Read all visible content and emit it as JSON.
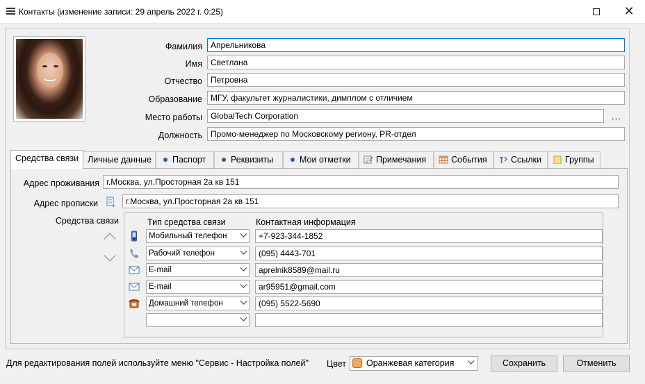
{
  "window": {
    "title": "Контакты  (изменение записи: 29 апрель 2022 г. 0:25)",
    "maximize_label": "☐",
    "close_label": "✕"
  },
  "person": {
    "fields": [
      {
        "label": "Фамилия",
        "value": "Апрельникова"
      },
      {
        "label": "Имя",
        "value": "Светлана"
      },
      {
        "label": "Отчество",
        "value": "Петровна"
      },
      {
        "label": "Образование",
        "value": "МГУ, факультет журналистики, димплом с отличием"
      },
      {
        "label": "Место работы",
        "value": "GlobalTech Corporation"
      },
      {
        "label": "Должность",
        "value": "Промо-менеджер по Московскому региону, PR-отдел"
      }
    ],
    "workplace_more": "..."
  },
  "tabs": [
    {
      "label": "Средства связи",
      "icon": "none"
    },
    {
      "label": "Личные данные",
      "icon": "none"
    },
    {
      "label": "Паспорт",
      "icon": "dot"
    },
    {
      "label": "Реквизиты",
      "icon": "dot"
    },
    {
      "label": "Мои отметки",
      "icon": "dot"
    },
    {
      "label": "Примечания",
      "icon": "note-icon"
    },
    {
      "label": "События",
      "icon": "calendar-icon"
    },
    {
      "label": "Ссылки",
      "icon": "link-icon"
    },
    {
      "label": "Группы",
      "icon": "folder-icon"
    }
  ],
  "contact": {
    "address_live_label": "Адрес проживания",
    "address_live": "г.Москва, ул.Просторная 2а кв 151",
    "address_reg_label": "Адрес прописки",
    "address_reg": "г.Москва, ул.Просторная 2а кв 151",
    "means_label": "Средства связи",
    "col_type": "Тип средства связи",
    "col_info": "Контактная информация",
    "rows": [
      {
        "icon": "mobile-phone-icon",
        "type": "Мобильный телефон",
        "value": "+7-923-344-1852"
      },
      {
        "icon": "work-phone-icon",
        "type": "Рабочий телефон",
        "value": "(095) 4443-701"
      },
      {
        "icon": "email-icon",
        "type": "E-mail",
        "value": "aprelnik8589@mail.ru"
      },
      {
        "icon": "email-icon",
        "type": "E-mail",
        "value": "ar95951@gmail.com"
      },
      {
        "icon": "home-phone-icon",
        "type": "Домашний телефон",
        "value": "(095) 5522-5690"
      },
      {
        "icon": "none",
        "type": "",
        "value": ""
      }
    ]
  },
  "footer": {
    "hint": "Для редактирования полей используйте меню \"Сервис - Настройка полей\"",
    "color_label": "Цвет",
    "color_value": "Оранжевая категория",
    "color_swatch": "#f4a460",
    "save": "Сохранить",
    "cancel": "Отменить"
  }
}
